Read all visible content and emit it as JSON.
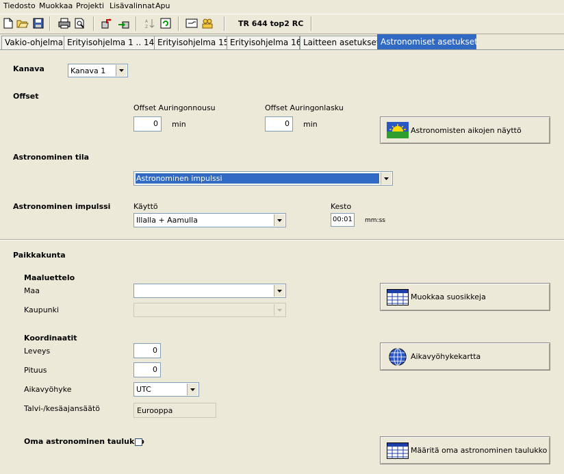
{
  "menu": {
    "items": [
      "Tiedosto",
      "Muokkaa",
      "Projekti",
      "Lisävalinnat",
      "Apu"
    ]
  },
  "toolbar": {
    "title": "TR 644 top2 RC",
    "icons": [
      "new-file-icon",
      "open-folder-icon",
      "save-icon",
      "print-icon",
      "print-preview-icon",
      "upload-icon",
      "download-icon",
      "sort-icon",
      "refresh-icon",
      "monitor-icon",
      "users-icon"
    ]
  },
  "tabs": [
    {
      "label": "Vakio-ohjelma"
    },
    {
      "label": "Erityisohjelma 1 .. 14"
    },
    {
      "label": "Erityisohjelma 15"
    },
    {
      "label": "Erityisohjelma 16"
    },
    {
      "label": "Laitteen asetukset"
    },
    {
      "label": "Astronomiset asetukset",
      "active": true
    }
  ],
  "channel": {
    "label": "Kanava",
    "value": "Kanava 1"
  },
  "offset": {
    "label": "Offset",
    "sunrise_label": "Offset  Auringonnousu",
    "sunrise_value": "0",
    "sunset_label": "Offset  Auringonlasku",
    "sunset_value": "0",
    "unit": "min",
    "show_times_button": "Astronomisten aikojen näyttö"
  },
  "astro_state": {
    "label": "Astronominen tila",
    "value": "Astronominen impulssi"
  },
  "astro_impulse": {
    "label": "Astronominen impulssi",
    "usage_label": "Käyttö",
    "usage_value": "Illalla + Aamulla",
    "duration_label": "Kesto",
    "duration_value": "00:01",
    "duration_unit": "mm:ss"
  },
  "location": {
    "label": "Paikkakunta",
    "country_list_label": "Maaluettelo",
    "country_label": "Maa",
    "country_value": "",
    "city_label": "Kaupunki",
    "city_value": "",
    "favorites_button": "Muokkaa suosikkeja",
    "coords_label": "Koordinaatit",
    "lat_label": "Leveys",
    "lat_value": "0",
    "lon_label": "Pituus",
    "lon_value": "0",
    "tz_label": "Aikavyöhyke",
    "tz_value": "UTC",
    "tz_map_button": "Aikavyöhykekartta",
    "dst_label": "Talvi-/kesäajansäätö",
    "dst_value": "Eurooppa"
  },
  "custom_table": {
    "label": "Oma astronominen taulukko",
    "checked": false,
    "define_button": "Määritä oma astronominen taulukko"
  },
  "colors": {
    "accent": "#316ac5",
    "background": "#ece9d8"
  }
}
